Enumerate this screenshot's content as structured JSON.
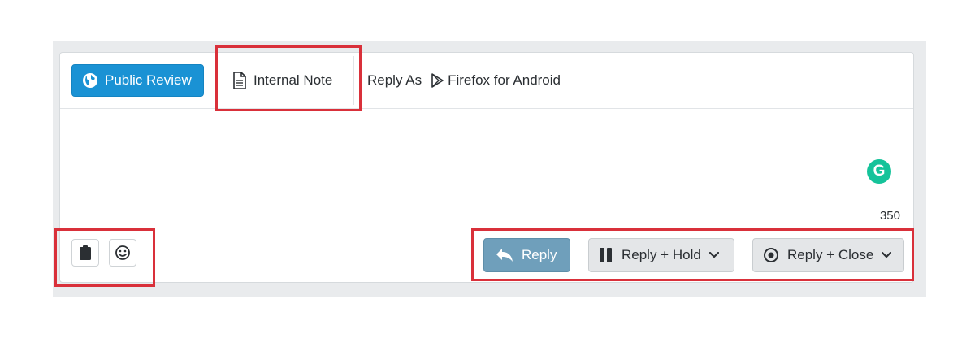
{
  "tabs": {
    "public_review": {
      "label": "Public Review",
      "icon": "globe-icon",
      "color": "#1a92d4"
    },
    "internal_note": {
      "label": "Internal Note",
      "icon": "document-icon"
    }
  },
  "reply_as": {
    "label": "Reply As",
    "channel": "Firefox for Android",
    "channel_icon": "play-store-icon"
  },
  "editor": {
    "grammarly_letter": "G",
    "char_count": "350"
  },
  "toolbar_left": [
    {
      "name": "clipboard-button",
      "icon": "clipboard-icon"
    },
    {
      "name": "emoji-button",
      "icon": "smiley-icon"
    }
  ],
  "actions": {
    "reply": {
      "label": "Reply",
      "icon": "reply-arrow-icon"
    },
    "reply_hold": {
      "label": "Reply + Hold",
      "icon": "pause-icon"
    },
    "reply_close": {
      "label": "Reply + Close",
      "icon": "radio-dot-icon"
    }
  },
  "colors": {
    "highlight": "#d9303a",
    "primary": "#1a92d4",
    "reply_button": "#6f9fbb",
    "grammarly": "#15c39a"
  }
}
